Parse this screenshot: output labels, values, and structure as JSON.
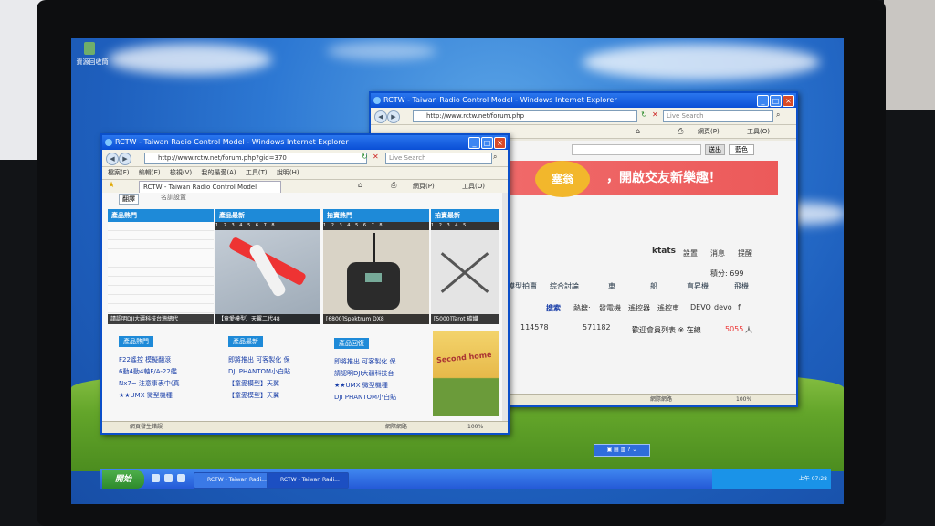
{
  "desktop": {
    "recycle_bin_label": "資源回收筒"
  },
  "back_window": {
    "title": "RCTW - Taiwan Radio Control Model - Windows Internet Explorer",
    "address": "http://www.rctw.net/forum.php",
    "search_placeholder": "Live Search",
    "tools_page_label": "網頁(P)",
    "tools_label": "工具(O)",
    "search_field_button": "送出",
    "color_label": "藍色",
    "banner_badge": "塞翁",
    "banner_text": "，開啟交友新樂趣！",
    "user_name": "ktats",
    "user_links": [
      "設置",
      "消息",
      "提醒"
    ],
    "points_label": "積分: 699",
    "nav_items": [
      "模型拍賣",
      "綜合討論",
      "車",
      "船",
      "直昇機",
      "飛機"
    ],
    "hot_search_label": "熱搜:",
    "search_button": "搜索",
    "hot_terms": [
      "發電機",
      "遙控器",
      "遙控車",
      "DEVO",
      "devo",
      "f"
    ],
    "stat_1": "114578",
    "stat_2": "571182",
    "member_text": "歡迎會員列表 ※ 在線",
    "online_count": "5055",
    "online_suffix": "人",
    "status_zone": "網際網路",
    "status_zoom": "100%"
  },
  "front_window": {
    "title": "RCTW - Taiwan Radio Control Model - Windows Internet Explorer",
    "address": "http://www.rctw.net/forum.php?gid=370",
    "search_placeholder": "Live Search",
    "menu": [
      "檔案(F)",
      "編輯(E)",
      "檢視(V)",
      "我的最愛(A)",
      "工具(T)",
      "說明(H)"
    ],
    "tab_title": "RCTW - Taiwan Radio Control Model",
    "tools_page_label": "網頁(P)",
    "tools_label": "工具(O)",
    "translate_label": "翻譯",
    "top_label": "名訓設置",
    "panels": [
      {
        "head": "產品熱門",
        "caption": "請認明DJI大疆科技台灣總代"
      },
      {
        "head": "產品最新",
        "caption": "【童愛模型】天翼二代48"
      },
      {
        "head": "拍賣熱門",
        "caption": "[6800]Spektrum DX8"
      },
      {
        "head": "拍賣最新",
        "caption": "[5000]Tarot 碳纖"
      }
    ],
    "col1_tag": "產品熱門",
    "col1_links": [
      "F22遙控 模擬翻滾",
      "6動4動4軸F/A-22艦",
      "Nx7~ 注意事表中(真",
      "★★UMX 微型機種"
    ],
    "col2_tag": "產品最新",
    "col2_links": [
      "即將推出 可客製化 保",
      "DJI PHANTOM小白貼",
      "【童愛模型】天翼",
      "【童愛模型】天翼"
    ],
    "col3_tag": "產品回復",
    "col3_links": [
      "即將推出 可客製化 保",
      "請認明DJI大疆科技台",
      "★★UMX 微型機種",
      "DJI PHANTOM小白貼"
    ],
    "col4_image_text": "Second home",
    "status_text": "網頁發生錯誤",
    "status_zone": "網際網路",
    "status_zoom": "100%"
  },
  "taskbar": {
    "start_label": "開始",
    "tasks": [
      "RCTW - Taiwan Radi...",
      "RCTW - Taiwan Radi..."
    ],
    "clock": "上午 07:28"
  },
  "colors": {
    "xp_blue": "#0b4fc9",
    "banner_red": "#ec5a5a",
    "panel_blue": "#1e8ad8",
    "grass_green": "#63a52a"
  }
}
